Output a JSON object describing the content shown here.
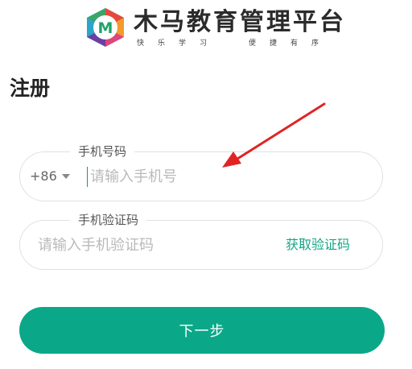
{
  "brand": {
    "badge_letter": "M",
    "title": "木马教育管理平台",
    "slogan_left": [
      "快",
      "乐",
      "学",
      "习"
    ],
    "slogan_right": [
      "便",
      "捷",
      "有",
      "序"
    ],
    "colors": {
      "badge_letter": "#21a36a",
      "hexagon": [
        "#e8483b",
        "#f39b2a",
        "#2ba6c9",
        "#6a3ea3",
        "#3aa66a",
        "#e0457b"
      ]
    }
  },
  "page": {
    "title": "注册"
  },
  "form": {
    "phone": {
      "label": "手机号码",
      "country_code": "+86",
      "placeholder": "请输入手机号",
      "value": ""
    },
    "code": {
      "label": "手机验证码",
      "placeholder": "请输入手机验证码",
      "value": "",
      "get_code_label": "获取验证码"
    },
    "next_label": "下一步"
  },
  "annotation": {
    "type": "arrow",
    "color": "#e02424"
  },
  "theme": {
    "primary": "#0aa888",
    "link": "#16a585",
    "border": "#e1e1e1"
  }
}
